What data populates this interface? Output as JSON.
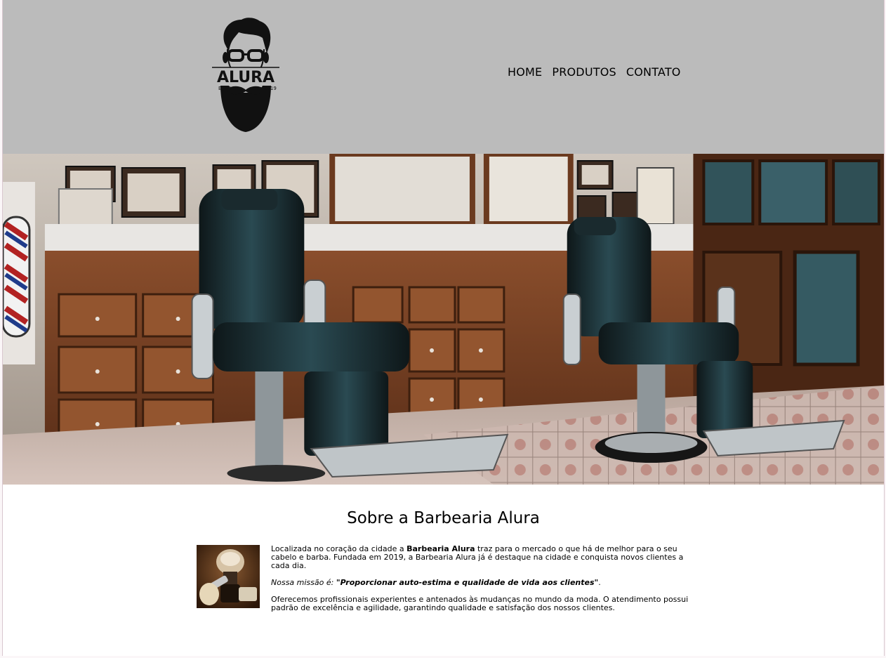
{
  "logo": {
    "brand": "ALURA",
    "estd_label": "ESTD",
    "year": "2019"
  },
  "nav": {
    "items": [
      "HOME",
      "PRODUTOS",
      "CONTATO"
    ]
  },
  "hero": {
    "image": "barbershop-interior"
  },
  "about": {
    "title": "Sobre a Barbearia Alura",
    "image": "shaving-brush-and-razor",
    "p1_a": "Localizada no coração da cidade a ",
    "p1_b": "Barbearia Alura",
    "p1_c": " traz para o mercado o que há de melhor para o seu cabelo e barba. Fundada em 2019, a Barbearia Alura já é destaque na cidade e conquista novos clientes a cada dia.",
    "p2_a": "Nossa missão é: ",
    "p2_b": "\"Proporcionar auto-estima e qualidade de vida aos clientes\"",
    "p2_c": ".",
    "p3": "Oferecemos profissionais experientes e antenados às mudanças no mundo da moda. O atendimento possui padrão de excelência e agilidade, garantindo qualidade e satisfação dos nossos clientes."
  },
  "colors": {
    "header_bg": "#bbbbbb",
    "page_bg": "#ffffff",
    "wood": "#7a4528",
    "leather": "#1b2a2e"
  }
}
